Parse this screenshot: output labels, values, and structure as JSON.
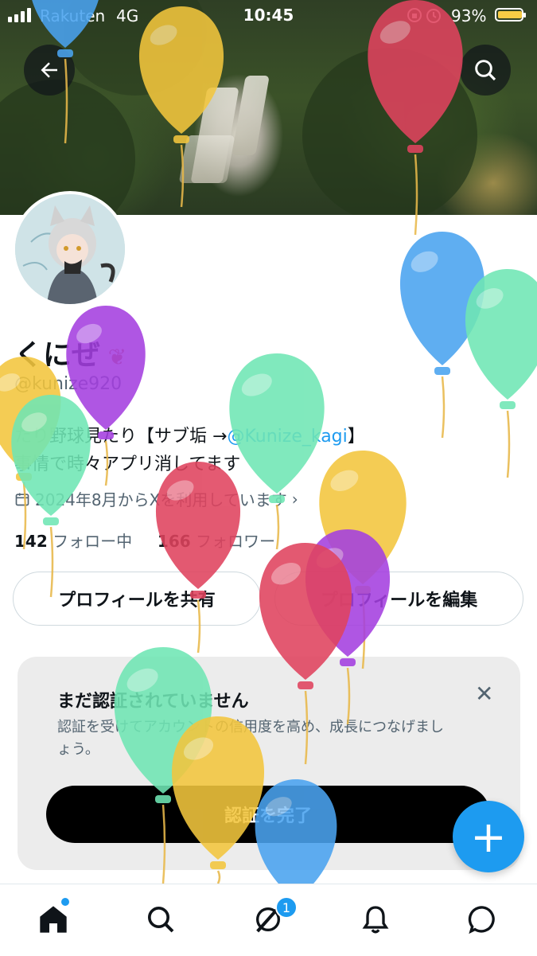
{
  "status_bar": {
    "carrier": "Rakuten",
    "network": "4G",
    "time": "10:45",
    "battery_pct": "93%",
    "battery_level": 0.93
  },
  "header": {
    "back_icon": "arrow-left-icon",
    "search_icon": "search-icon"
  },
  "profile": {
    "display_name": "くにぜ",
    "handle": "@kunize920",
    "bio_line1_prefix": "たり野球見たり【サブ垢 →",
    "bio_link": "@Kunize_kagi",
    "bio_line1_suffix": "】",
    "bio_line2": "事情で時々アプリ消してます",
    "joined": "2024年8月からXを利用しています",
    "following_count": "142",
    "following_label": "フォロー中",
    "followers_count": "166",
    "followers_label": "フォロワー"
  },
  "buttons": {
    "share_profile": "プロフィールを共有",
    "edit_profile": "プロフィールを編集"
  },
  "verify_card": {
    "title": "まだ認証されていません",
    "description": "認証を受けてアカウントの信用度を高め、成長につなげましょう。",
    "cta": "認証を完了",
    "close_icon": "close-icon"
  },
  "fab": {
    "icon": "plus-icon",
    "label": "+"
  },
  "tabbar": {
    "items": [
      "home-icon",
      "search-icon",
      "grok-icon",
      "bell-icon",
      "chat-icon"
    ],
    "notification_badge": "1"
  },
  "colors": {
    "accent": "#1d9bf0",
    "balloon_red": "#e0435e",
    "balloon_yellow": "#f3c63d",
    "balloon_blue": "#4aa3f0",
    "balloon_green": "#6fe6b4",
    "balloon_purple": "#a43fe0"
  }
}
